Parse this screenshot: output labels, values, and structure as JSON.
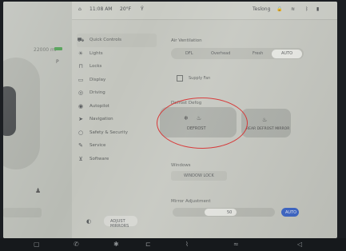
{
  "topbar": {
    "left_icon": "car-icon",
    "time": "11:08 AM",
    "temp": "20°F",
    "profile": "Teslong",
    "status_icons": [
      "lock-icon",
      "wifi-icon",
      "bluetooth-icon",
      "signal-icon"
    ]
  },
  "left_panel": {
    "mileage": "22000 mi",
    "gear": "P"
  },
  "sidebar": {
    "items": [
      {
        "icon": "car-icon",
        "label": "Quick Controls"
      },
      {
        "icon": "lights-icon",
        "label": "Lights"
      },
      {
        "icon": "lock-icon",
        "label": "Locks"
      },
      {
        "icon": "display-icon",
        "label": "Display"
      },
      {
        "icon": "steering-icon",
        "label": "Driving"
      },
      {
        "icon": "autopilot-icon",
        "label": "Autopilot"
      },
      {
        "icon": "navigation-icon",
        "label": "Navigation"
      },
      {
        "icon": "shield-icon",
        "label": "Safety & Security"
      },
      {
        "icon": "wrench-icon",
        "label": "Service"
      },
      {
        "icon": "software-icon",
        "label": "Software"
      }
    ]
  },
  "main": {
    "heading1": "Air Ventilation",
    "seg_options": [
      "DFL",
      "Overhead",
      "Fresh",
      "AUTO"
    ],
    "checkbox_label": "Supply Fan",
    "defrost_heading": "Defrost Defog",
    "defrost_btn": {
      "glyph1": "❄",
      "glyph2": "♨",
      "label": "DEFROST"
    },
    "defrost_btn2": {
      "glyph": "♨",
      "label": "REAR DEFROST MIRROR"
    },
    "windows_heading": "Windows",
    "windows_btn": "WINDOW LOCK",
    "mirror_heading": "Mirror Adjustment",
    "slider_value": "50",
    "slider_level": 0.45,
    "auto_label": "AUTO"
  },
  "bottom": {
    "mirror_button": "ADJUST MIRRORS"
  },
  "dock": [
    "menu-icon",
    "phone-icon",
    "fan-icon",
    "seat-icon",
    "temperature-icon",
    "seat-heat-icon",
    "volume-icon"
  ]
}
